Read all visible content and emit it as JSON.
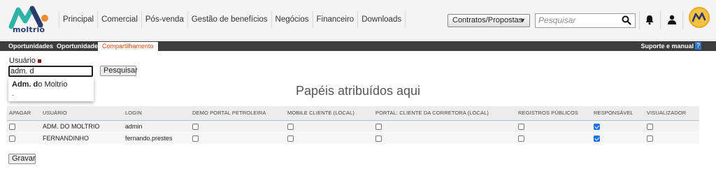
{
  "brand": {
    "name": "moltrio",
    "colors": {
      "teal": "#2fb3a8",
      "navy": "#2a3c6b",
      "orange": "#f28b30",
      "tab_active_text": "#d44a0a",
      "checkbox_checked": "#1a73e8",
      "tabbar": "#3c3c3c"
    }
  },
  "nav": [
    "Principal",
    "Comercial",
    "Pós-venda",
    "Gestão de benefícios",
    "Negócios",
    "Financeiro",
    "Downloads"
  ],
  "header": {
    "context_select": {
      "value": "Contratos/Propostas"
    },
    "search": {
      "placeholder": "Pesquisar"
    },
    "icons": [
      "search-icon",
      "bell-icon",
      "user-icon",
      "avatar"
    ]
  },
  "tabs": [
    {
      "label": "Oportunidades",
      "active": false
    },
    {
      "label": "Oportunidade",
      "active": false
    },
    {
      "label": "Compartilhamento",
      "active": true
    }
  ],
  "support": {
    "label": "Suporte e manual",
    "badge": "?"
  },
  "user_search": {
    "label": "Usuário",
    "value": "adm. d",
    "button": "Pesquisar",
    "suggestion": {
      "match": "Adm. d",
      "rest": "o Moltrio",
      "sub": "-"
    }
  },
  "section_title": "Papéis atribuídos aqui",
  "table": {
    "columns": [
      "APAGAR",
      "USUÁRIO",
      "LOGIN",
      "DEMO PORTAL PETROLEIRA",
      "MOBILE CLIENTE (LOCAL)",
      "PORTAL: CLIENTE DA CORRETORA (LOCAL)",
      "REGISTROS PÚBLICOS",
      "RESPONSÁVEL",
      "VISUALIZADOR"
    ],
    "rows": [
      {
        "usuario": "ADM. DO MOLTRIO",
        "login": "admin",
        "apagar": false,
        "demo": false,
        "mobile": false,
        "portal": false,
        "registros": false,
        "responsavel": true,
        "visualizador": false
      },
      {
        "usuario": "FERNANDINHO",
        "login": "fernando.prestes",
        "apagar": false,
        "demo": false,
        "mobile": false,
        "portal": false,
        "registros": false,
        "responsavel": true,
        "visualizador": false
      }
    ]
  },
  "save_button": "Gravar"
}
